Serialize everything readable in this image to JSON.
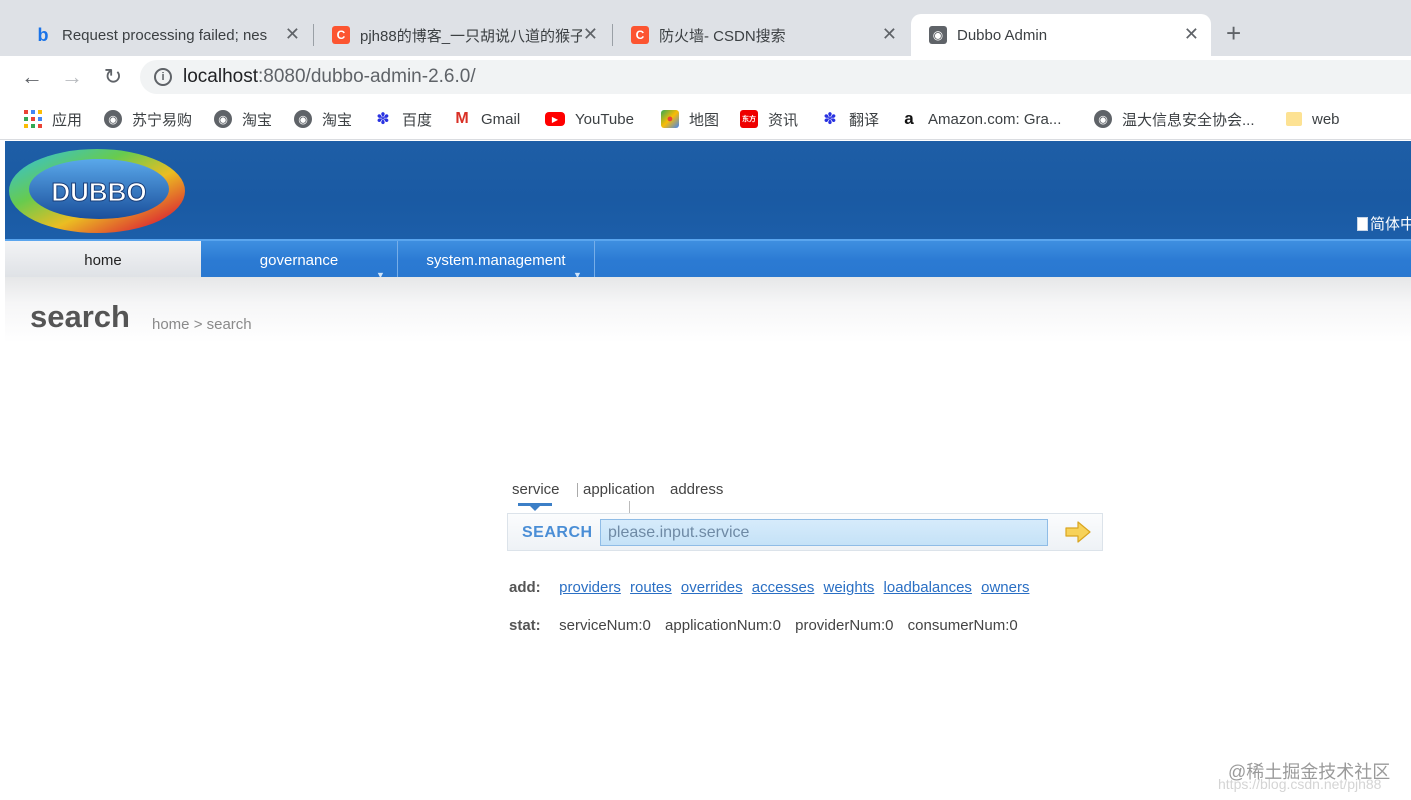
{
  "browser": {
    "tabs": [
      {
        "title": "Request processing failed; nes",
        "favicon": "bing-icon",
        "active": false
      },
      {
        "title": "pjh88的博客_一只胡说八道的猴子",
        "favicon": "csdn-icon",
        "active": false
      },
      {
        "title": "防火墙- CSDN搜索",
        "favicon": "csdn-icon",
        "active": false
      },
      {
        "title": "Dubbo Admin",
        "favicon": "globe-icon",
        "active": true
      }
    ],
    "address": {
      "host": "localhost",
      "rest": ":8080/dubbo-admin-2.6.0/"
    },
    "bookmarks": [
      {
        "label": "应用",
        "icon": "apps-grid-icon"
      },
      {
        "label": "苏宁易购",
        "icon": "globe-icon"
      },
      {
        "label": "淘宝",
        "icon": "globe-icon"
      },
      {
        "label": "淘宝",
        "icon": "globe-icon"
      },
      {
        "label": "百度",
        "icon": "baidu-paw-icon"
      },
      {
        "label": "Gmail",
        "icon": "gmail-icon"
      },
      {
        "label": "YouTube",
        "icon": "youtube-icon"
      },
      {
        "label": "地图",
        "icon": "maps-icon"
      },
      {
        "label": "资讯",
        "icon": "eastmoney-icon"
      },
      {
        "label": "翻译",
        "icon": "baidu-paw-icon"
      },
      {
        "label": "Amazon.com: Gra...",
        "icon": "amazon-icon"
      },
      {
        "label": "温大信息安全协会...",
        "icon": "globe-icon"
      },
      {
        "label": "web",
        "icon": "folder-icon"
      }
    ],
    "colors": {
      "chrome_bg": "#dee1e6",
      "csdn": "#fc5531",
      "youtube": "#ff0000"
    }
  },
  "app": {
    "logo_text": "DUBBO",
    "language_link": "简体中",
    "menu": [
      {
        "label": "home",
        "active": true,
        "has_dropdown": false
      },
      {
        "label": "governance",
        "active": false,
        "has_dropdown": true
      },
      {
        "label": "system.management",
        "active": false,
        "has_dropdown": true
      }
    ],
    "page_title": "search",
    "breadcrumb": "home > search",
    "search_tabs": [
      "service",
      "application",
      "address"
    ],
    "search_label": "SEARCH",
    "search_placeholder": "please.input.service",
    "add_label": "add:",
    "add_links": [
      "providers",
      "routes",
      "overrides",
      "accesses",
      "weights",
      "loadbalances",
      "owners"
    ],
    "stat_label": "stat:",
    "stats": [
      "serviceNum:0",
      "applicationNum:0",
      "providerNum:0",
      "consumerNum:0"
    ],
    "colors": {
      "header": "#1c5ea9",
      "menubar": "#2b7ad3",
      "link": "#2a6fc4"
    }
  },
  "watermark": {
    "text": "@稀土掘金技术社区",
    "url_text": "https://blog.csdn.net/pjh88"
  }
}
